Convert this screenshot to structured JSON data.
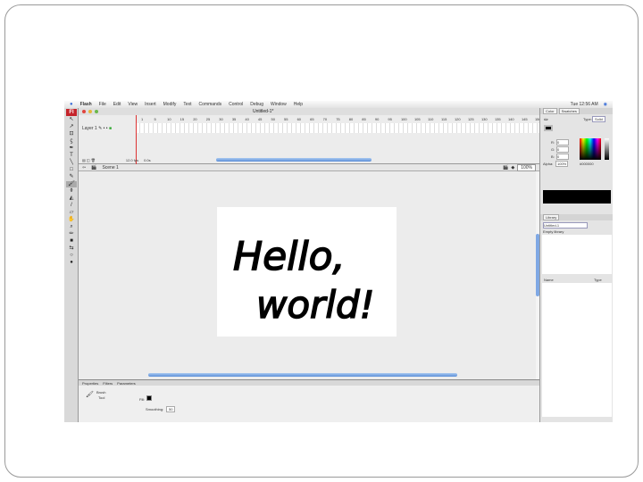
{
  "menubar": {
    "app": "Flash",
    "items": [
      "File",
      "Edit",
      "View",
      "Insert",
      "Modify",
      "Text",
      "Commands",
      "Control",
      "Debug",
      "Window",
      "Help"
    ],
    "clock": "Tue 12:56 AM"
  },
  "document": {
    "tab": "Untitled-1*",
    "scene": "Scene 1",
    "zoom": "100%",
    "layer": "Layer 1",
    "fps": "12.0 fps",
    "time": "0.0s"
  },
  "timeline": {
    "ruler": [
      "1",
      "5",
      "10",
      "15",
      "20",
      "25",
      "30",
      "35",
      "40",
      "45",
      "50",
      "55",
      "60",
      "65",
      "70",
      "75",
      "80",
      "85",
      "90",
      "95",
      "100",
      "105",
      "110",
      "115",
      "120",
      "125",
      "130",
      "135",
      "140",
      "145",
      "150"
    ]
  },
  "stage": {
    "line1": "Hello,",
    "line2": "world!"
  },
  "color_panel": {
    "tabs": [
      "Color",
      "Swatches"
    ],
    "type_label": "Type:",
    "type_value": "Solid",
    "r_label": "R:",
    "r": "0",
    "g_label": "G:",
    "g": "0",
    "b_label": "B:",
    "b": "0",
    "alpha_label": "Alpha:",
    "alpha": "100%",
    "hex": "#000000"
  },
  "library_panel": {
    "tab": "Library",
    "doc": "Untitled-1",
    "status": "Empty library",
    "col_name": "Name",
    "col_type": "Type"
  },
  "properties": {
    "tabs": [
      "Properties",
      "Filters",
      "Parameters"
    ],
    "tool": "Brush",
    "tool_sub": "Tool",
    "fill_label": "Fill:",
    "smoothing_label": "Smoothing:",
    "smoothing": "50"
  },
  "colors": {
    "accent": "#5b8fd8",
    "flash_red": "#c4242b"
  }
}
